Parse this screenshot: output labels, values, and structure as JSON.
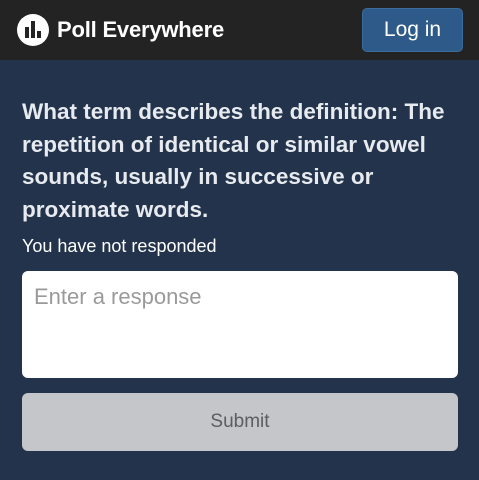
{
  "header": {
    "brand_name": "Poll Everywhere",
    "login_label": "Log in"
  },
  "poll": {
    "question": "What term describes the definition: The repetition of identical or similar vowel sounds, usually in successive or proximate words.",
    "status": "You have not responded",
    "response_placeholder": "Enter a response",
    "submit_label": "Submit"
  },
  "icons": {
    "logo": "poll-everywhere-logo-icon"
  },
  "colors": {
    "page_background": "#22334b",
    "header_background": "#232323",
    "login_button": "#2d5a88",
    "submit_disabled": "#c4c6c9"
  }
}
